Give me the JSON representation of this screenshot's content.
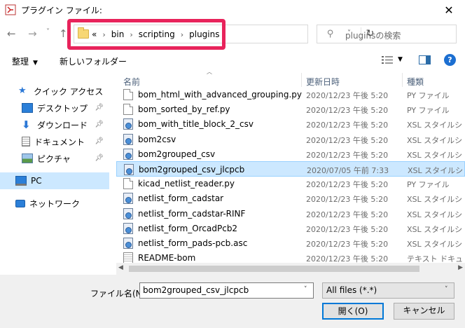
{
  "window": {
    "title": "プラグイン ファイル:",
    "close_glyph": "✕"
  },
  "address": {
    "overflow": "«",
    "crumbs": [
      "bin",
      "scripting",
      "plugins"
    ]
  },
  "search": {
    "placeholder": "pluginsの検索"
  },
  "toolbar": {
    "organize": "整理",
    "new_folder": "新しいフォルダー"
  },
  "nav": {
    "items": [
      {
        "label": "クイック アクセス",
        "icon": "star-icon",
        "pinned": false
      },
      {
        "label": "デスクトップ",
        "icon": "desktop-icon",
        "pinned": true
      },
      {
        "label": "ダウンロード",
        "icon": "download-icon",
        "pinned": true
      },
      {
        "label": "ドキュメント",
        "icon": "document-icon",
        "pinned": true
      },
      {
        "label": "ピクチャ",
        "icon": "picture-icon",
        "pinned": true
      },
      {
        "label": "PC",
        "icon": "pc-icon",
        "pinned": false,
        "selected": true
      },
      {
        "label": "ネットワーク",
        "icon": "network-icon",
        "pinned": false
      }
    ]
  },
  "columns": {
    "name": "名前",
    "date": "更新日時",
    "type": "種類"
  },
  "files": [
    {
      "name": "bom_html_with_advanced_grouping.py",
      "date": "2020/12/23 午後 5:20",
      "type": "PY ファイル",
      "icon": "doc"
    },
    {
      "name": "bom_sorted_by_ref.py",
      "date": "2020/12/23 午後 5:20",
      "type": "PY ファイル",
      "icon": "doc"
    },
    {
      "name": "bom_with_title_block_2_csv",
      "date": "2020/12/23 午後 5:20",
      "type": "XSL スタイルシ",
      "icon": "xsl"
    },
    {
      "name": "bom2csv",
      "date": "2020/12/23 午後 5:20",
      "type": "XSL スタイルシ",
      "icon": "xsl"
    },
    {
      "name": "bom2grouped_csv",
      "date": "2020/12/23 午後 5:20",
      "type": "XSL スタイルシ",
      "icon": "xsl"
    },
    {
      "name": "bom2grouped_csv_jlcpcb",
      "date": "2020/07/05 午前 7:33",
      "type": "XSL スタイルシ",
      "icon": "xsl",
      "selected": true
    },
    {
      "name": "kicad_netlist_reader.py",
      "date": "2020/12/23 午後 5:20",
      "type": "PY ファイル",
      "icon": "doc"
    },
    {
      "name": "netlist_form_cadstar",
      "date": "2020/12/23 午後 5:20",
      "type": "XSL スタイルシ",
      "icon": "xsl"
    },
    {
      "name": "netlist_form_cadstar-RINF",
      "date": "2020/12/23 午後 5:20",
      "type": "XSL スタイルシ",
      "icon": "xsl"
    },
    {
      "name": "netlist_form_OrcadPcb2",
      "date": "2020/12/23 午後 5:20",
      "type": "XSL スタイルシ",
      "icon": "xsl"
    },
    {
      "name": "netlist_form_pads-pcb.asc",
      "date": "2020/12/23 午後 5:20",
      "type": "XSL スタイルシ",
      "icon": "xsl"
    },
    {
      "name": "README-bom",
      "date": "2020/12/23 午後 5:20",
      "type": "テキスト ドキュ",
      "icon": "txt"
    }
  ],
  "bottom": {
    "filename_label": "ファイル名(N):",
    "filename_value": "bom2grouped_csv_jlcpcb",
    "filter_value": "All files (*.*)",
    "open_label": "開く(O)",
    "cancel_label": "キャンセル"
  },
  "colors": {
    "highlight": "#e8235b",
    "selection": "#cce8ff",
    "accent": "#0078d7"
  }
}
